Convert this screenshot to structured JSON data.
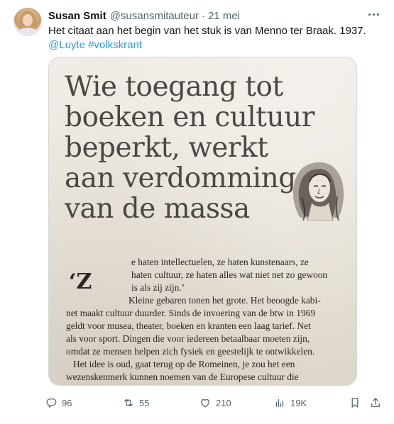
{
  "tweet": {
    "author_name": "Susan Smit",
    "author_handle": "@susansmitauteur",
    "separator": "·",
    "date": "21 mei",
    "text_line": "Het citaat aan het begin van het stuk is van Menno ter Braak. 1937.",
    "tags": [
      "@Luyte",
      "#volkskrant"
    ]
  },
  "image": {
    "quote_lines": [
      "Wie toegang tot",
      "boeken en cultuur",
      "beperkt, werkt",
      "aan verdomming",
      "van de massa"
    ],
    "dropcap": "‘Z",
    "article_lines": [
      "e haten intellectuelen, ze haten kunstenaars, ze",
      "haten cultuur, ze haten alles wat niet net zo gewoon",
      "is als zij zijn.’",
      "Kleine gebaren tonen het grote. Het beoogde kabi-",
      "net maakt cultuur duurder. Sinds de invoering van de btw in 1969",
      "geldt voor musea, theater, boeken en kranten een laag tarief. Net",
      "als voor sport. Dingen die voor iedereen betaalbaar moeten zijn,",
      "omdat ze mensen helpen zich fysiek en geestelijk te ontwikkelen.",
      "Het idee is oud, gaat terug op de Romeinen, je zou het een",
      "wezenskenmerk kunnen noemen van de Europese cultuur die"
    ]
  },
  "actions": {
    "replies": "96",
    "reposts": "55",
    "likes": "210",
    "views": "19K"
  },
  "icons": {
    "reply": "reply-icon",
    "repost": "repost-icon",
    "like": "heart-icon",
    "views": "views-icon",
    "bookmark": "bookmark-icon",
    "share": "share-icon",
    "more": "more-icon"
  }
}
